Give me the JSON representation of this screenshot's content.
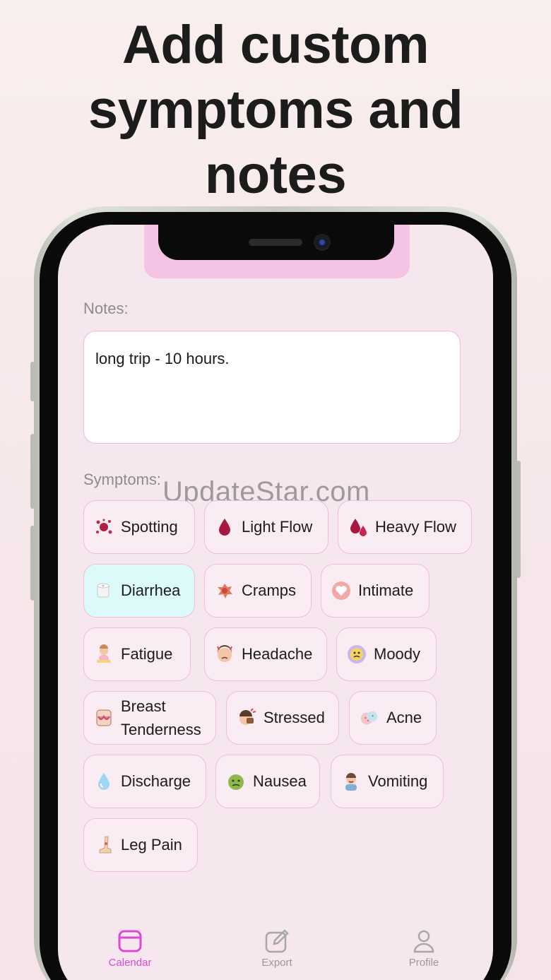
{
  "headline": {
    "line1": "Add custom",
    "line2": "symptoms and",
    "line3": "notes"
  },
  "notes": {
    "label": "Notes:",
    "value": "long trip - 10 hours."
  },
  "symptoms": {
    "label": "Symptoms:",
    "items": [
      {
        "label": "Spotting",
        "icon": "splatter-icon",
        "selected": false
      },
      {
        "label": "Light Flow",
        "icon": "drop-icon",
        "selected": false
      },
      {
        "label": "Heavy Flow",
        "icon": "drops-icon",
        "selected": false
      },
      {
        "label": "Diarrhea",
        "icon": "toilet-paper-icon",
        "selected": true
      },
      {
        "label": "Cramps",
        "icon": "cramps-icon",
        "selected": false
      },
      {
        "label": "Intimate",
        "icon": "heart-icon",
        "selected": false
      },
      {
        "label": "Fatigue",
        "icon": "tired-person-icon",
        "selected": false
      },
      {
        "label": "Headache",
        "icon": "headache-face-icon",
        "selected": false
      },
      {
        "label": "Moody",
        "icon": "moody-face-icon",
        "selected": false
      },
      {
        "label_line1": "Breast",
        "label_line2": "Tenderness",
        "icon": "bra-icon",
        "selected": false
      },
      {
        "label": "Stressed",
        "icon": "stressed-face-icon",
        "selected": false
      },
      {
        "label": "Acne",
        "icon": "acne-face-icon",
        "selected": false
      },
      {
        "label": "Discharge",
        "icon": "water-drop-icon",
        "selected": false
      },
      {
        "label": "Nausea",
        "icon": "nauseated-face-icon",
        "selected": false
      },
      {
        "label": "Vomiting",
        "icon": "vomiting-person-icon",
        "selected": false
      },
      {
        "label": "Leg Pain",
        "icon": "leg-icon",
        "selected": false
      }
    ]
  },
  "watermark": "UpdateStar.com",
  "tabs": [
    {
      "label": "Calendar",
      "icon": "calendar-icon",
      "active": true
    },
    {
      "label": "Export",
      "icon": "edit-icon",
      "active": false
    },
    {
      "label": "Profile",
      "icon": "person-icon",
      "active": false
    }
  ],
  "colors": {
    "accent": "#d94ad4",
    "chip_border": "#f0bce0",
    "selected_chip": "#dcfaf9",
    "screen_bg": "#f6e7ee"
  }
}
